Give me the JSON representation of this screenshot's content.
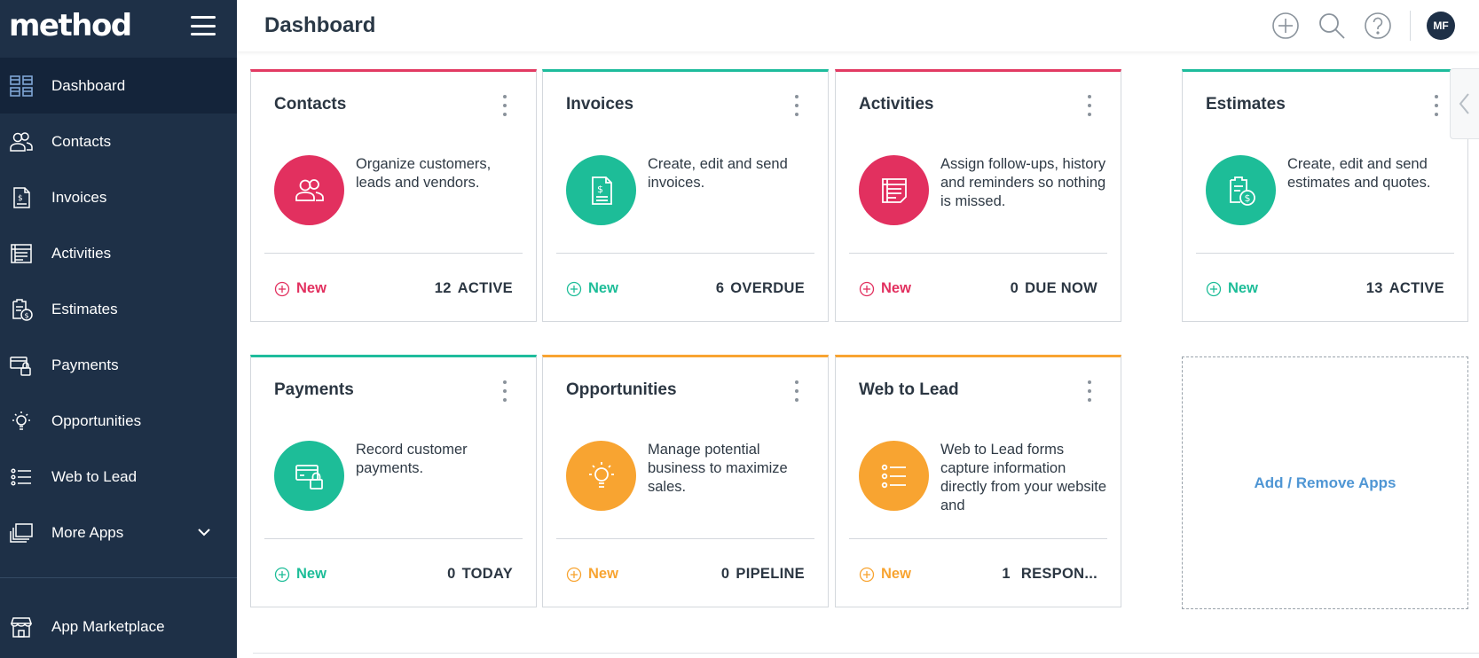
{
  "app": {
    "logo": "method",
    "page_title": "Dashboard"
  },
  "colors": {
    "sidebar_bg": "#1e3047",
    "sidebar_active": "#14243a",
    "red": "#e2305f",
    "teal": "#1dbd98",
    "orange": "#f8a431",
    "link_blue": "#4f96d4"
  },
  "sidebar": {
    "items": [
      {
        "label": "Dashboard",
        "icon": "dashboard-grid-icon",
        "active": true
      },
      {
        "label": "Contacts",
        "icon": "contacts-icon"
      },
      {
        "label": "Invoices",
        "icon": "invoice-icon"
      },
      {
        "label": "Activities",
        "icon": "activities-icon"
      },
      {
        "label": "Estimates",
        "icon": "estimates-icon"
      },
      {
        "label": "Payments",
        "icon": "payments-icon"
      },
      {
        "label": "Opportunities",
        "icon": "lightbulb-icon"
      },
      {
        "label": "Web to Lead",
        "icon": "list-icon"
      },
      {
        "label": "More Apps",
        "icon": "stack-icon"
      }
    ],
    "bottom": {
      "label": "App Marketplace",
      "icon": "storefront-icon"
    }
  },
  "topbar": {
    "avatar_initials": "MF",
    "icons": [
      "add-circle-icon",
      "search-icon",
      "help-icon"
    ]
  },
  "cards": [
    {
      "title": "Contacts",
      "desc": "Organize customers, leads and vendors.",
      "new_label": "New",
      "count": "12",
      "count_label": "ACTIVE",
      "accent": "red"
    },
    {
      "title": "Invoices",
      "desc": "Create, edit and send invoices.",
      "new_label": "New",
      "count": "6",
      "count_label": "OVERDUE",
      "accent": "teal"
    },
    {
      "title": "Activities",
      "desc": "Assign follow-ups, history and reminders so nothing is missed.",
      "new_label": "New",
      "count": "0",
      "count_label": "DUE NOW",
      "accent": "red"
    },
    {
      "title": "Estimates",
      "desc": "Create, edit and send estimates and quotes.",
      "new_label": "New",
      "count": "13",
      "count_label": "ACTIVE",
      "accent": "teal"
    },
    {
      "title": "Payments",
      "desc": "Record customer payments.",
      "new_label": "New",
      "count": "0",
      "count_label": "TODAY",
      "accent": "teal"
    },
    {
      "title": "Opportunities",
      "desc": "Manage potential business to maximize sales.",
      "new_label": "New",
      "count": "0",
      "count_label": "PIPELINE",
      "accent": "orange"
    },
    {
      "title": "Web to Lead",
      "desc": "Web to Lead forms capture information directly from your website and",
      "new_label": "New",
      "count": "1",
      "count_label": "RESPON...",
      "accent": "orange"
    }
  ],
  "add_remove_label": "Add / Remove Apps"
}
